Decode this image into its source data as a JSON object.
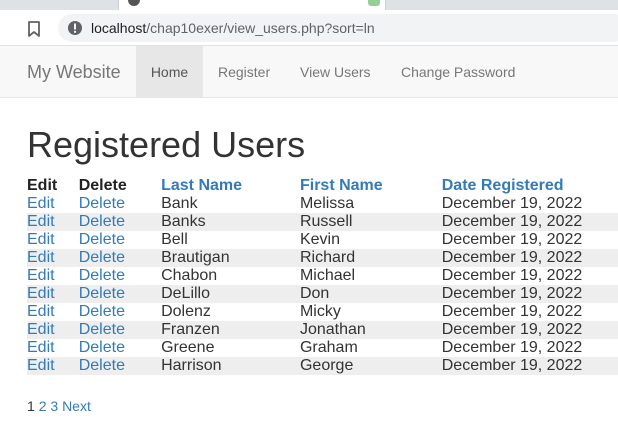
{
  "browser": {
    "url_host": "localhost",
    "url_path": "/chap10exer/view_users.php?sort=ln"
  },
  "navbar": {
    "brand": "My Website",
    "items": [
      {
        "label": "Home",
        "active": true
      },
      {
        "label": "Register",
        "active": false
      },
      {
        "label": "View Users",
        "active": false
      },
      {
        "label": "Change Password",
        "active": false
      }
    ]
  },
  "page": {
    "title": "Registered Users"
  },
  "table": {
    "headers": {
      "edit": "Edit",
      "delete": "Delete",
      "last_name": "Last Name",
      "first_name": "First Name",
      "date_registered": "Date Registered"
    },
    "edit_label": "Edit",
    "delete_label": "Delete",
    "rows": [
      {
        "last": "Bank",
        "first": "Melissa",
        "date": "December 19, 2022"
      },
      {
        "last": "Banks",
        "first": "Russell",
        "date": "December 19, 2022"
      },
      {
        "last": "Bell",
        "first": "Kevin",
        "date": "December 19, 2022"
      },
      {
        "last": "Brautigan",
        "first": "Richard",
        "date": "December 19, 2022"
      },
      {
        "last": "Chabon",
        "first": "Michael",
        "date": "December 19, 2022"
      },
      {
        "last": "DeLillo",
        "first": "Don",
        "date": "December 19, 2022"
      },
      {
        "last": "Dolenz",
        "first": "Micky",
        "date": "December 19, 2022"
      },
      {
        "last": "Franzen",
        "first": "Jonathan",
        "date": "December 19, 2022"
      },
      {
        "last": "Greene",
        "first": "Graham",
        "date": "December 19, 2022"
      },
      {
        "last": "Harrison",
        "first": "George",
        "date": "December 19, 2022"
      }
    ]
  },
  "pagination": {
    "current": "1",
    "pages": [
      "2",
      "3"
    ],
    "next": "Next"
  },
  "colors": {
    "link": "#337ab7",
    "row_shade": "#eeeeee",
    "navbar_bg": "#f8f8f8",
    "nav_active_bg": "#e7e7e7"
  },
  "icons": {
    "bookmark": "bookmark-icon",
    "site_info": "info-icon"
  }
}
